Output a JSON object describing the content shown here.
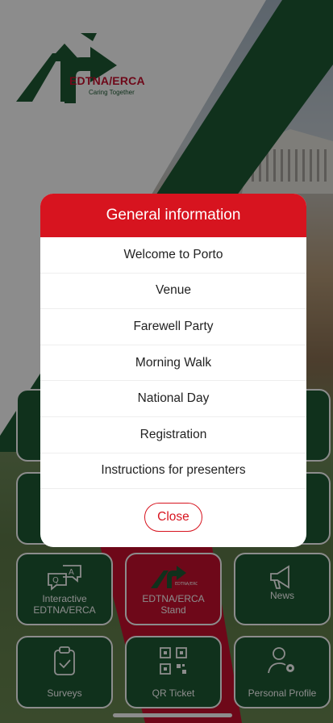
{
  "logo": {
    "name": "EDTNA/ERCA",
    "tagline": "Caring Together"
  },
  "tiles": {
    "interactive": "Interactive EDTNA/ERCA",
    "stand": "EDTNA/ERCA Stand",
    "news": "News",
    "surveys": "Surveys",
    "qr_ticket": "QR Ticket",
    "profile": "Personal Profile"
  },
  "modal": {
    "title": "General information",
    "items": [
      "Welcome to Porto",
      "Venue",
      "Farewell Party",
      "Morning Walk",
      "National Day",
      "Registration",
      "Instructions for presenters"
    ],
    "close_label": "Close"
  },
  "colors": {
    "brand_green": "#1e5a34",
    "brand_red": "#c8102e",
    "header_red": "#d7141f"
  }
}
